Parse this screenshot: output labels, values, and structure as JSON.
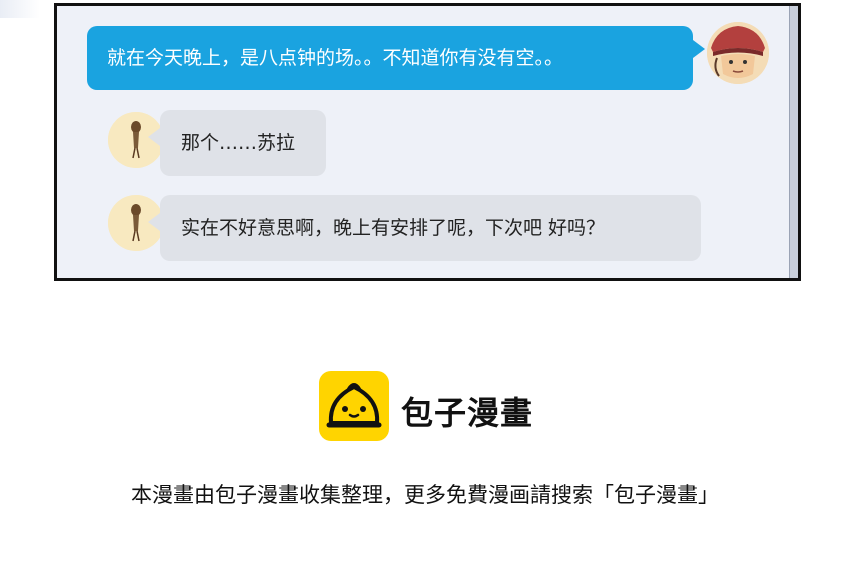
{
  "conversation": {
    "messages": [
      {
        "side": "outgoing",
        "text": "就在今天晚上，是八点钟的场。。不知道你有没有空。。"
      },
      {
        "side": "incoming",
        "text": "那个……苏拉"
      },
      {
        "side": "incoming",
        "text": "实在不好意思啊，晚上有安排了呢，下次吧 好吗？"
      }
    ]
  },
  "watermark": {
    "brand": "包子漫畫",
    "note": "本漫畫由包子漫畫收集整理，更多免費漫画請搜索「包子漫畫」"
  },
  "colors": {
    "outgoing_bubble": "#1aa3e0",
    "incoming_bubble": "#dfe2e8",
    "chat_background": "#eef1f8",
    "logo_yellow": "#ffd400"
  }
}
